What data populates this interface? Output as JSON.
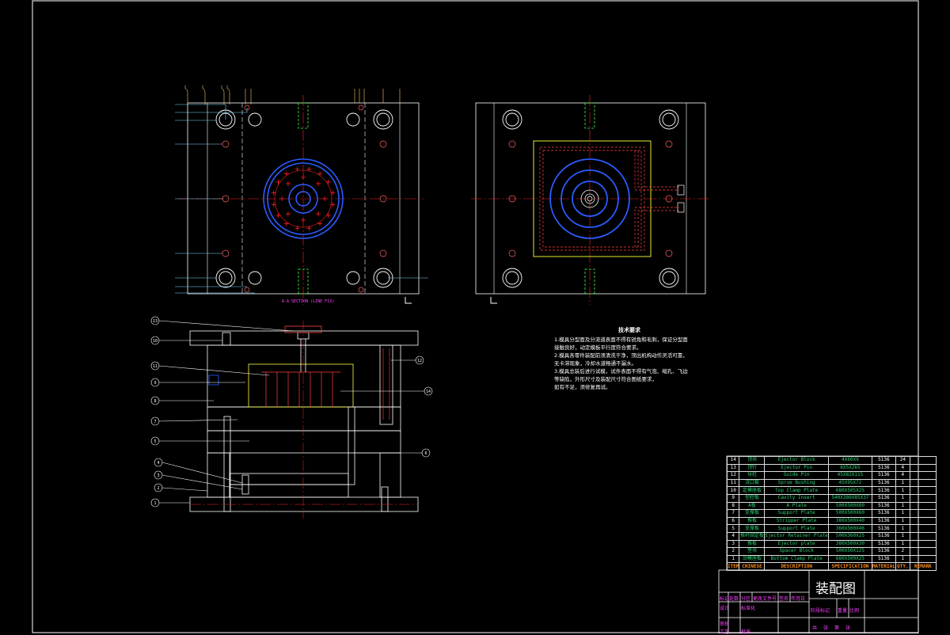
{
  "drawing": {
    "section_caption": "A-A SECTION (LINE FIX)",
    "title": "装配图",
    "colors": {
      "outline": "#ffffff",
      "center": "#ff2020",
      "hidden": "#40ff40",
      "cavity": "#2b5bff",
      "leader": "#7fd6ff",
      "insert": "#ffff40",
      "label": "#ff40ff",
      "header": "#ff8c1a"
    }
  },
  "balloons": [
    "13",
    "10",
    "11",
    "9",
    "8",
    "7",
    "5",
    "4",
    "3",
    "2",
    "1",
    "12",
    "14",
    "6"
  ],
  "notes": {
    "title": "技术要求",
    "lines": [
      "1.模具分型面及分流道表面不得有锐角和毛刺，保证分型面",
      "接触良好，动定模板平行度符合要求。",
      "2.模具各零件装配前须清洗干净，顶出机构动作灵活可靠，",
      "无卡滞现象，冷却水道畅通不漏水。",
      "3.模具总装后进行试模，试件表面不得有气泡、缩孔、飞边",
      "等缺陷，外形尺寸及装配尺寸符合图纸要求，",
      "如有不足，须修复再试。"
    ]
  },
  "bom": {
    "header": [
      "ITEM",
      "CHINESE",
      "DESCRIPTION",
      "SPECIFICATION",
      "MATERIAL",
      "QTY.",
      "REMARK"
    ],
    "rows": [
      [
        "14",
        "顶块",
        "Ejector Block",
        "4X60X9",
        "S136",
        "24",
        ""
      ],
      [
        "13",
        "顶针",
        "Ejector Pin",
        "8X5X265",
        "S136",
        "4",
        ""
      ],
      [
        "12",
        "导柱",
        "Guide Pin",
        "45X82X115",
        "S136",
        "4",
        ""
      ],
      [
        "11",
        "浇口套",
        "Sprue Bushing",
        "45X95X72",
        "S136",
        "1",
        ""
      ],
      [
        "10",
        "定模座板",
        "Top Clamp Plate",
        "680X505X25",
        "S136",
        "1",
        ""
      ],
      [
        "9",
        "型腔板",
        "Cavity Insert",
        "540X380X85X37",
        "S136",
        "1",
        ""
      ],
      [
        "8",
        "A板",
        "A Plate",
        "500X500X80",
        "S136",
        "1",
        ""
      ],
      [
        "7",
        "支撑板",
        "Support Plate",
        "500X500X60",
        "S136",
        "1",
        ""
      ],
      [
        "6",
        "推板",
        "Stripper Plate",
        "380X500X40",
        "S136",
        "1",
        ""
      ],
      [
        "5",
        "支撑板",
        "Support Plate",
        "360X500X46",
        "S136",
        "1",
        ""
      ],
      [
        "4",
        "推杆固定板",
        "Ejector Retainer Plate",
        "500X360X25",
        "S136",
        "1",
        ""
      ],
      [
        "3",
        "推板",
        "Ejector plate",
        "380X500X30",
        "S136",
        "1",
        ""
      ],
      [
        "2",
        "垫块",
        "Spacer Block",
        "500X50X125",
        "S136",
        "2",
        ""
      ],
      [
        "1",
        "动模座板",
        "Bottom Clamp Plate",
        "680X500X25",
        "S136",
        "1",
        ""
      ]
    ]
  },
  "title_block": {
    "labels": [
      "标记",
      "处数",
      "分区",
      "更改文件号",
      "签名",
      "年月日",
      "设计",
      "标准化",
      "审核",
      "工艺",
      "批准",
      "阶段标记",
      "重量",
      "比例",
      "共",
      "张",
      "第",
      "张"
    ]
  }
}
